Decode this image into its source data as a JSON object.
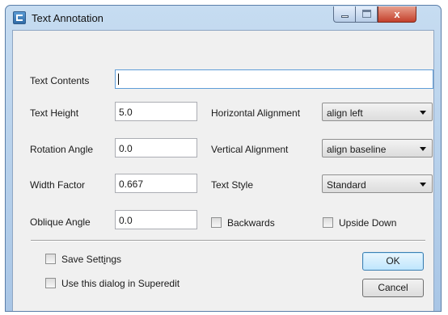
{
  "window": {
    "title": "Text Annotation",
    "close_glyph": "x"
  },
  "form": {
    "text_contents": {
      "label": "Text Contents",
      "value": ""
    },
    "text_height": {
      "label": "Text Height",
      "value": "5.0"
    },
    "rotation_angle": {
      "label": "Rotation Angle",
      "value": "0.0"
    },
    "width_factor": {
      "label": "Width Factor",
      "value": "0.667"
    },
    "oblique_angle": {
      "label": "Oblique Angle",
      "value": "0.0"
    },
    "horizontal_alignment": {
      "label": "Horizontal Alignment",
      "value": "align left"
    },
    "vertical_alignment": {
      "label": "Vertical Alignment",
      "value": "align baseline"
    },
    "text_style": {
      "label": "Text Style",
      "value": "Standard"
    },
    "backwards": {
      "label": "Backwards",
      "checked": false
    },
    "upside_down": {
      "label": "Upside Down",
      "checked": false
    }
  },
  "options": {
    "save_settings": {
      "label_prefix": "Save Sett",
      "label_mnemonic": "i",
      "label_suffix": "ngs",
      "checked": false
    },
    "use_in_superedit": {
      "label": "Use this dialog in Superedit",
      "checked": false
    }
  },
  "buttons": {
    "ok": "OK",
    "cancel": "Cancel"
  },
  "colors": {
    "title_bar": "#b9d1ea",
    "close_button": "#c3402c",
    "dialog_face": "#f0f0f0"
  }
}
